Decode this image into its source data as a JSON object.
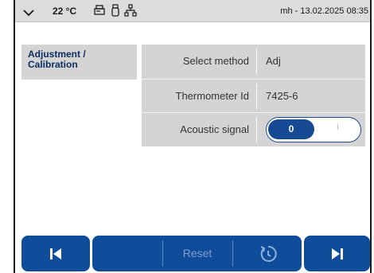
{
  "status_bar": {
    "temperature": "22 °C",
    "user_time": "mh - 13.02.2025 08:35",
    "icons": [
      "chevron-down-icon",
      "printer-icon",
      "usb-icon",
      "network-icon"
    ]
  },
  "sidebar": {
    "items": [
      {
        "label": "Adjustment / Calibration"
      }
    ]
  },
  "settings": {
    "rows": [
      {
        "label": "Select method",
        "value": "Adj"
      },
      {
        "label": "Thermometer Id",
        "value": "7425-6"
      },
      {
        "label": "Acoustic signal",
        "toggle_on": "0",
        "toggle_off": "I",
        "state": "0"
      }
    ]
  },
  "bottom_bar": {
    "prev": "skip-previous-icon",
    "reset_label": "Reset",
    "history": "history-icon",
    "next": "skip-next-icon"
  },
  "colors": {
    "accent": "#0f4c99",
    "panel": "#d4d4d4",
    "status_bar": "#dcdcdc",
    "sidebar_text": "#0b2f63"
  }
}
